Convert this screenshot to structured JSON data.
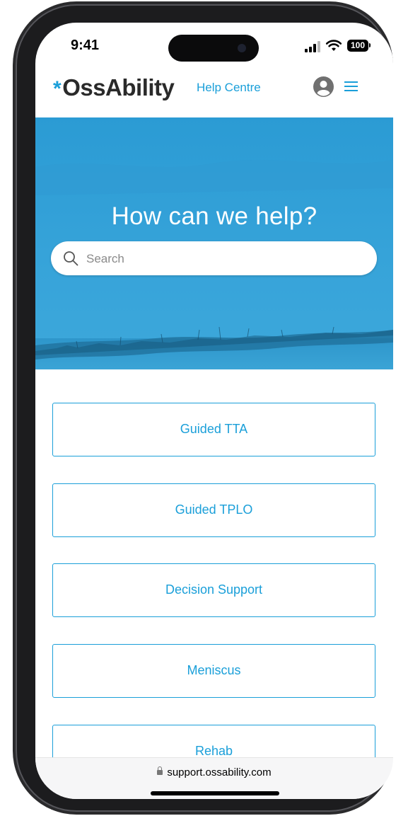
{
  "status_bar": {
    "time": "9:41",
    "battery": "100"
  },
  "header": {
    "brand_star": "*",
    "brand": "OssAbility",
    "section": "Help Centre",
    "accent_color": "#1a9fd9",
    "icons": [
      "user-avatar-icon",
      "hamburger-menu-icon"
    ]
  },
  "hero": {
    "title": "How can we help?",
    "search_placeholder": "Search",
    "search_value": ""
  },
  "categories": [
    {
      "label": "Guided TTA"
    },
    {
      "label": "Guided TPLO"
    },
    {
      "label": "Decision Support"
    },
    {
      "label": "Meniscus"
    },
    {
      "label": "Rehab"
    }
  ],
  "browser": {
    "url": "support.ossability.com"
  }
}
